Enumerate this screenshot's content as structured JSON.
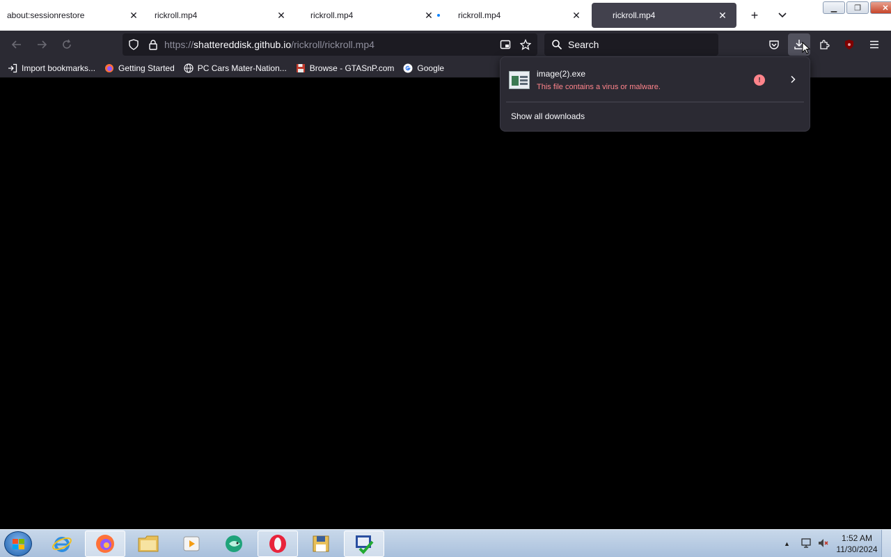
{
  "tabs": [
    {
      "title": "about:sessionrestore",
      "active": false,
      "dot": false
    },
    {
      "title": "rickroll.mp4",
      "active": false,
      "dot": false
    },
    {
      "title": "rickroll.mp4",
      "active": false,
      "dot": false
    },
    {
      "title": "rickroll.mp4",
      "active": false,
      "dot": true
    },
    {
      "title": "rickroll.mp4",
      "active": true,
      "dot": false
    }
  ],
  "urlbar": {
    "scheme": "https://",
    "host": "shattereddisk.github.io",
    "path": "/rickroll/rickroll.mp4"
  },
  "search": {
    "placeholder": "Search"
  },
  "bookmarks": [
    {
      "label": "Import bookmarks...",
      "icon": "import-icon"
    },
    {
      "label": "Getting Started",
      "icon": "firefox-icon"
    },
    {
      "label": "PC Cars Mater-Nation...",
      "icon": "globe-icon"
    },
    {
      "label": "Browse - GTASnP.com",
      "icon": "floppy-icon"
    },
    {
      "label": "Google",
      "icon": "google-icon"
    }
  ],
  "downloads": {
    "file_name": "image(2).exe",
    "status": "This file contains a virus or malware.",
    "show_all": "Show all downloads",
    "warn_glyph": "!"
  },
  "clock": {
    "time": "1:52 AM",
    "date": "11/30/2024"
  },
  "colors": {
    "accent": "#0a84ff",
    "danger": "#ff848b",
    "toolbar": "#2b2a33"
  }
}
